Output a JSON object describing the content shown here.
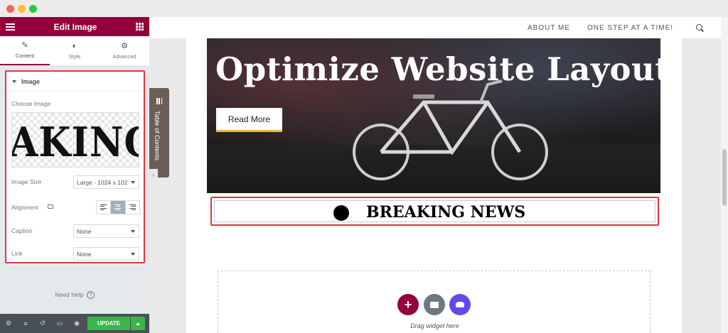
{
  "window": {
    "controls": [
      "close",
      "minimize",
      "maximize"
    ]
  },
  "panel": {
    "title": "Edit Image",
    "menu_icon": "hamburger-icon",
    "widgets_icon": "grid-icon",
    "tabs": [
      {
        "label": "Content",
        "icon": "pencil-icon",
        "active": true
      },
      {
        "label": "Style",
        "icon": "contrast-icon",
        "active": false
      },
      {
        "label": "Advanced",
        "icon": "gear-icon",
        "active": false
      }
    ],
    "section": {
      "title": "Image",
      "choose_image_label": "Choose Image",
      "image_preview_text": "AKING",
      "image_size": {
        "label": "Image Size",
        "value": "Large - 1024 x 102"
      },
      "alignment": {
        "label": "Alignment",
        "selected": "center"
      },
      "caption": {
        "label": "Caption",
        "value": "None"
      },
      "link": {
        "label": "Link",
        "value": "None"
      }
    },
    "help": {
      "label": "Need Help",
      "icon": "?"
    },
    "footer": {
      "update_label": "UPDATE"
    }
  },
  "toc_tab": {
    "label": "Table of Contents"
  },
  "site": {
    "nav": [
      {
        "label": "ABOUT ME"
      },
      {
        "label": "ONE STEP AT A TIME!"
      }
    ],
    "hero": {
      "title": "Optimize Website Layout",
      "button_label": "Read More"
    },
    "breaking_news": {
      "text": "BREAKING NEWS"
    },
    "dropzone": {
      "text": "Drag widget here",
      "add_icon": "+"
    }
  },
  "colors": {
    "brand": "#93003c",
    "highlight": "#e0363f",
    "update": "#39b54a",
    "accent": "#f0b43c"
  }
}
